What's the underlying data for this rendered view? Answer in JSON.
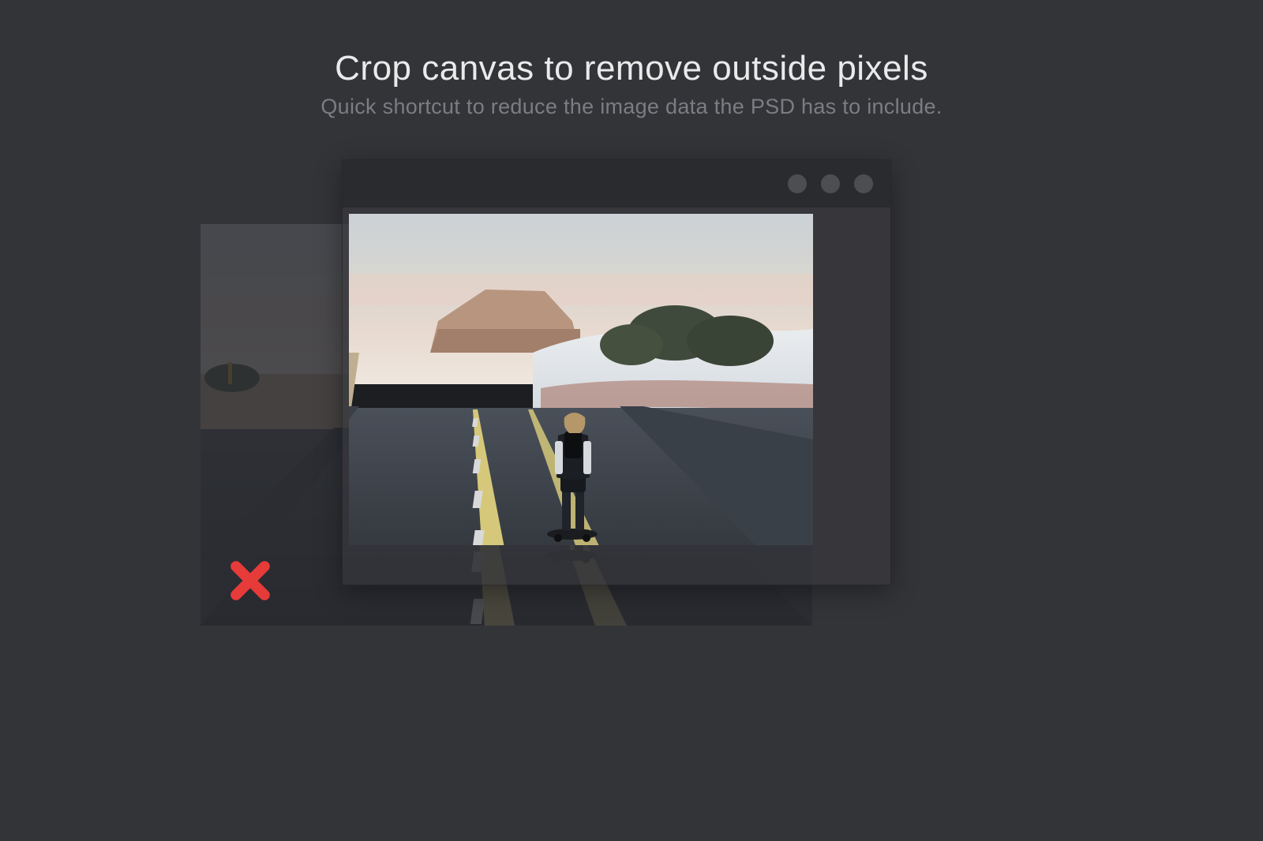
{
  "heading": {
    "title": "Crop canvas to remove outside pixels",
    "subtitle": "Quick shortcut to reduce the image data the PSD has to include."
  },
  "colors": {
    "bg": "#333438",
    "text": "#eaeaeb",
    "subtext": "#7b7d82",
    "titlebar": "#2a2b2f",
    "windot": "#4d4e52",
    "error": "#e73b39"
  },
  "window": {
    "dots": 3
  },
  "badge": {
    "kind": "x-error"
  }
}
